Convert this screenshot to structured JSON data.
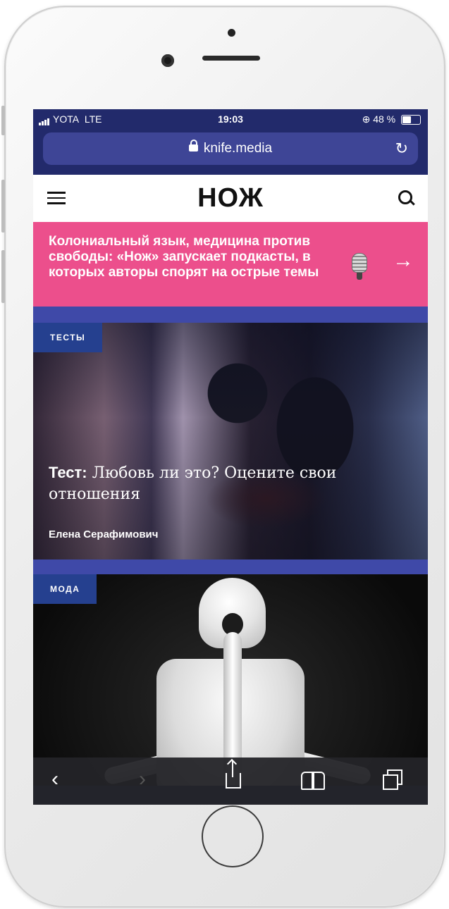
{
  "status_bar": {
    "carrier": "YOTA",
    "network": "LTE",
    "time": "19:03",
    "battery": "48 %",
    "battery_fraction": 0.48
  },
  "browser": {
    "url": "knife.media",
    "lock_icon": "lock-icon",
    "reload_icon": "reload-icon"
  },
  "site_header": {
    "logo": "НОЖ",
    "menu_icon": "hamburger-icon",
    "search_icon": "search-icon"
  },
  "promo": {
    "text": "Колониальный язык, медицина против свободы: «Нож» запускает подкасты, в которых авторы спорят на острые темы",
    "arrow": "→",
    "icon": "microphone-icon"
  },
  "articles": [
    {
      "tag": "ТЕСТЫ",
      "title_prefix": "Тест:",
      "title": " Любовь ли это? Оцените свои отношения",
      "author": "Елена Серафимович"
    },
    {
      "tag": "МОДА"
    }
  ],
  "toolbar": {
    "back": "‹",
    "forward": "›",
    "share_icon": "share-icon",
    "bookmarks_icon": "book-icon",
    "tabs_icon": "tabs-icon"
  },
  "colors": {
    "browser_chrome": "#222a6b",
    "url_field": "#3e4596",
    "promo_bg": "#ec4f8c",
    "divider": "#3f49a8",
    "tag_bg": "#25408f"
  }
}
